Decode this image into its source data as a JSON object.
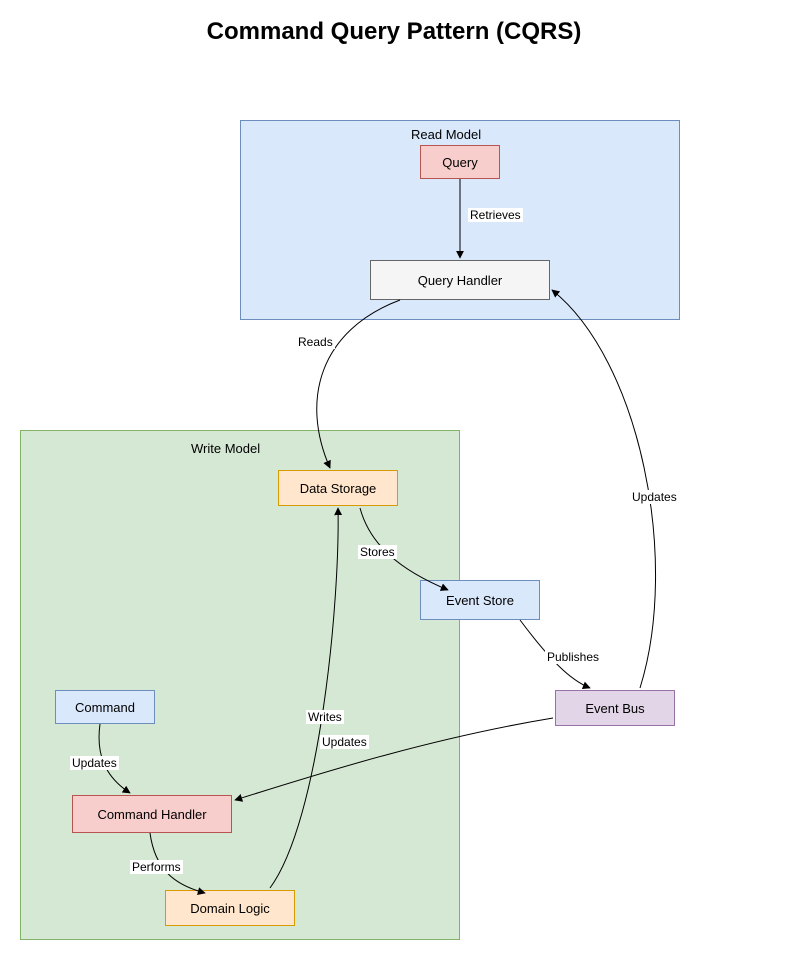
{
  "title": "Command Query Pattern (CQRS)",
  "containers": {
    "read_model": {
      "label": "Read Model"
    },
    "write_model": {
      "label": "Write Model"
    }
  },
  "nodes": {
    "query": {
      "label": "Query"
    },
    "query_handler": {
      "label": "Query Handler"
    },
    "data_storage": {
      "label": "Data Storage"
    },
    "event_store": {
      "label": "Event Store"
    },
    "event_bus": {
      "label": "Event Bus"
    },
    "command": {
      "label": "Command"
    },
    "command_handler": {
      "label": "Command Handler"
    },
    "domain_logic": {
      "label": "Domain Logic"
    }
  },
  "edges": {
    "retrieves": {
      "label": "Retrieves"
    },
    "reads": {
      "label": "Reads"
    },
    "updates_bus_qh": {
      "label": "Updates"
    },
    "stores": {
      "label": "Stores"
    },
    "publishes": {
      "label": "Publishes"
    },
    "updates_bus_ch": {
      "label": "Updates"
    },
    "updates_cmd_ch": {
      "label": "Updates"
    },
    "performs": {
      "label": "Performs"
    },
    "writes": {
      "label": "Writes"
    }
  }
}
